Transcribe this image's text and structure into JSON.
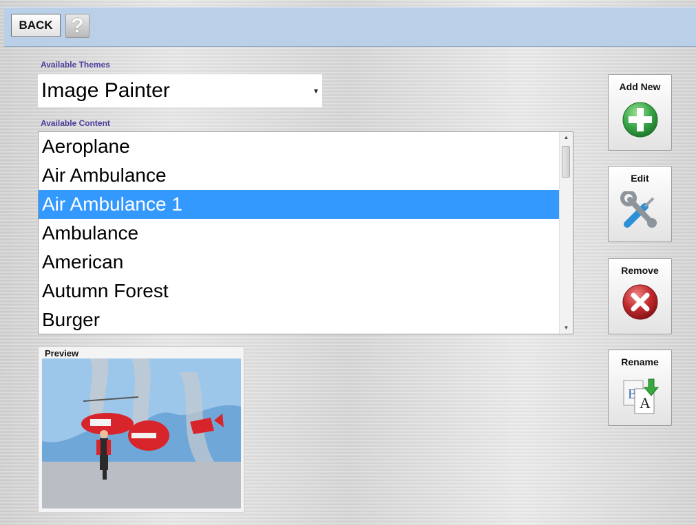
{
  "toolbar": {
    "back_label": "BACK",
    "help_icon_glyph": "?"
  },
  "themes": {
    "label": "Available Themes",
    "selected": "Image Painter"
  },
  "content": {
    "label": "Available Content",
    "items": [
      "Aeroplane",
      "Air Ambulance",
      "Air Ambulance 1",
      "Ambulance",
      "American",
      "Autumn Forest",
      "Burger"
    ],
    "selected_index": 2
  },
  "preview": {
    "label": "Preview",
    "image_icon": "helicopter-paint-icon"
  },
  "actions": {
    "add_label": "Add New",
    "edit_label": "Edit",
    "remove_label": "Remove",
    "rename_label": "Rename"
  },
  "colors": {
    "topbar": "#b9d0e8",
    "selection": "#3399ff",
    "label_text": "#4a3d9a",
    "add_green": "#3aa64a",
    "remove_red": "#c0292c"
  }
}
